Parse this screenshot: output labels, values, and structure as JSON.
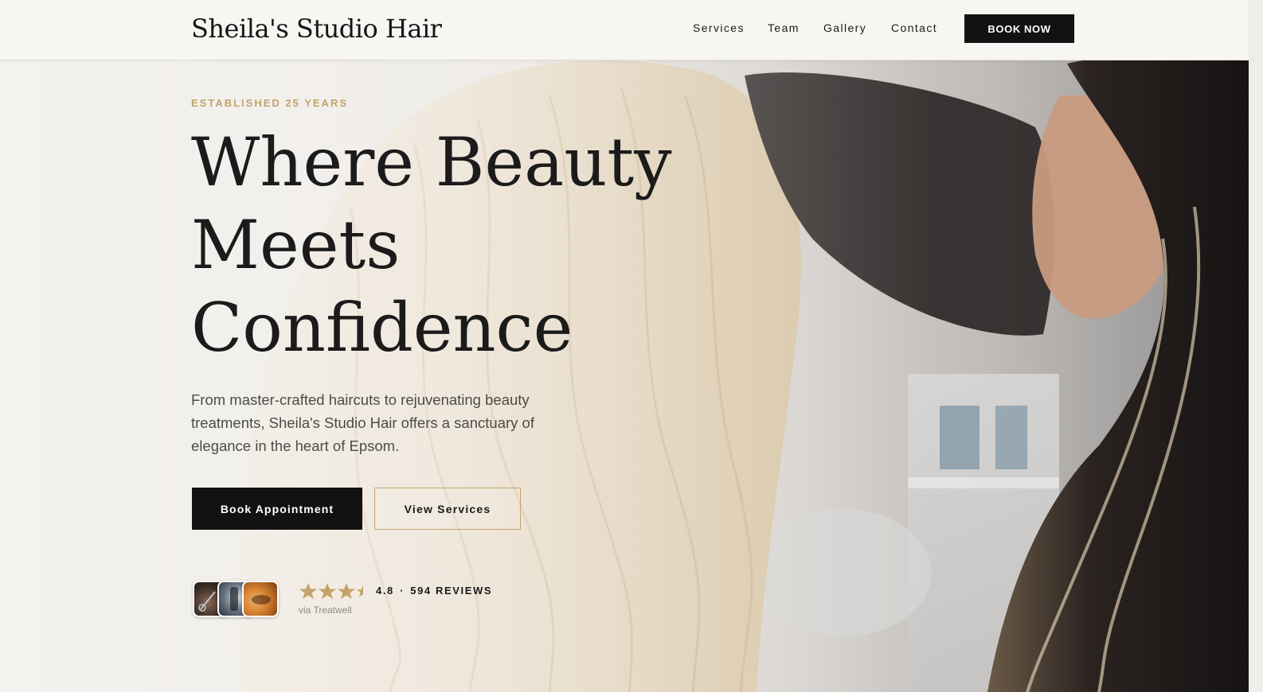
{
  "header": {
    "brand": "Sheila's Studio Hair",
    "nav": [
      {
        "label": "Services"
      },
      {
        "label": "Team"
      },
      {
        "label": "Gallery"
      },
      {
        "label": "Contact"
      }
    ],
    "cta": "BOOK NOW"
  },
  "hero": {
    "eyebrow": "ESTABLISHED 25 YEARS",
    "headline_lines": [
      "Where Beauty",
      "Meets",
      "Confidence"
    ],
    "subcopy": "From master-crafted haircuts to rejuvenating beauty treatments, Sheila's Studio Hair offers a sanctuary of elegance in the heart of Epsom.",
    "primary_button": "Book Appointment",
    "secondary_button": "View Services"
  },
  "reviews": {
    "rating": "4.8",
    "separator": "·",
    "count_label": "594 REVIEWS",
    "rating_value": 4.8,
    "rating_max": 5,
    "source": "via Treatwell",
    "thumbnails": [
      "salon-photo-cutting-icon",
      "salon-photo-styling-icon",
      "salon-photo-treatment-icon"
    ]
  },
  "colors": {
    "accent_gold": "#c4a36a",
    "button_dark": "#121212",
    "header_bg": "#f7f6f3",
    "text_dark": "#1a1a1a"
  }
}
